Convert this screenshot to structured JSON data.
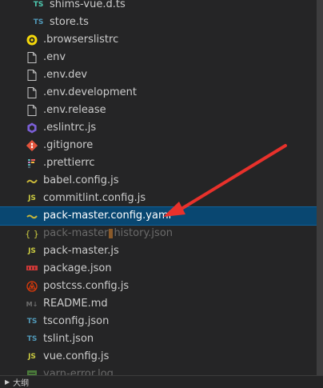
{
  "tree": {
    "items": [
      {
        "label": "shims-vue.d.ts",
        "icon": "typescript-def-icon",
        "glyph": "TS"
      },
      {
        "label": "store.ts",
        "icon": "typescript-icon",
        "glyph": "TS"
      },
      {
        "label": ".browserslistrc",
        "icon": "browserslist-icon",
        "glyph": ""
      },
      {
        "label": ".env",
        "icon": "file-icon",
        "glyph": ""
      },
      {
        "label": ".env.dev",
        "icon": "file-icon",
        "glyph": ""
      },
      {
        "label": ".env.development",
        "icon": "file-icon",
        "glyph": ""
      },
      {
        "label": ".env.release",
        "icon": "file-icon",
        "glyph": ""
      },
      {
        "label": ".eslintrc.js",
        "icon": "eslint-icon",
        "glyph": ""
      },
      {
        "label": ".gitignore",
        "icon": "git-icon",
        "glyph": ""
      },
      {
        "label": ".prettierrc",
        "icon": "prettier-icon",
        "glyph": ""
      },
      {
        "label": "babel.config.js",
        "icon": "babel-icon",
        "glyph": ""
      },
      {
        "label": "commitlint.config.js",
        "icon": "javascript-icon",
        "glyph": "JS"
      },
      {
        "label": "pack-master.config.yaml",
        "icon": "yaml-icon",
        "glyph": ""
      },
      {
        "label_pre": "pack-master",
        "label_post": "history.json",
        "icon": "json-icon",
        "glyph": "{ }"
      },
      {
        "label": "pack-master.js",
        "icon": "javascript-icon",
        "glyph": "JS"
      },
      {
        "label": "package.json",
        "icon": "npm-icon",
        "glyph": ""
      },
      {
        "label": "postcss.config.js",
        "icon": "postcss-icon",
        "glyph": ""
      },
      {
        "label": "README.md",
        "icon": "markdown-icon",
        "glyph": "M↓"
      },
      {
        "label": "tsconfig.json",
        "icon": "tsconfig-icon",
        "glyph": "TS"
      },
      {
        "label": "tslint.json",
        "icon": "tslint-icon",
        "glyph": "TS"
      },
      {
        "label": "vue.config.js",
        "icon": "javascript-icon",
        "glyph": "JS"
      },
      {
        "label": "yarn-error.log",
        "icon": "log-icon",
        "glyph": ""
      }
    ]
  },
  "status": {
    "label": "大纲"
  },
  "colors": {
    "selected": "#094771",
    "arrow": "#e8312b"
  }
}
